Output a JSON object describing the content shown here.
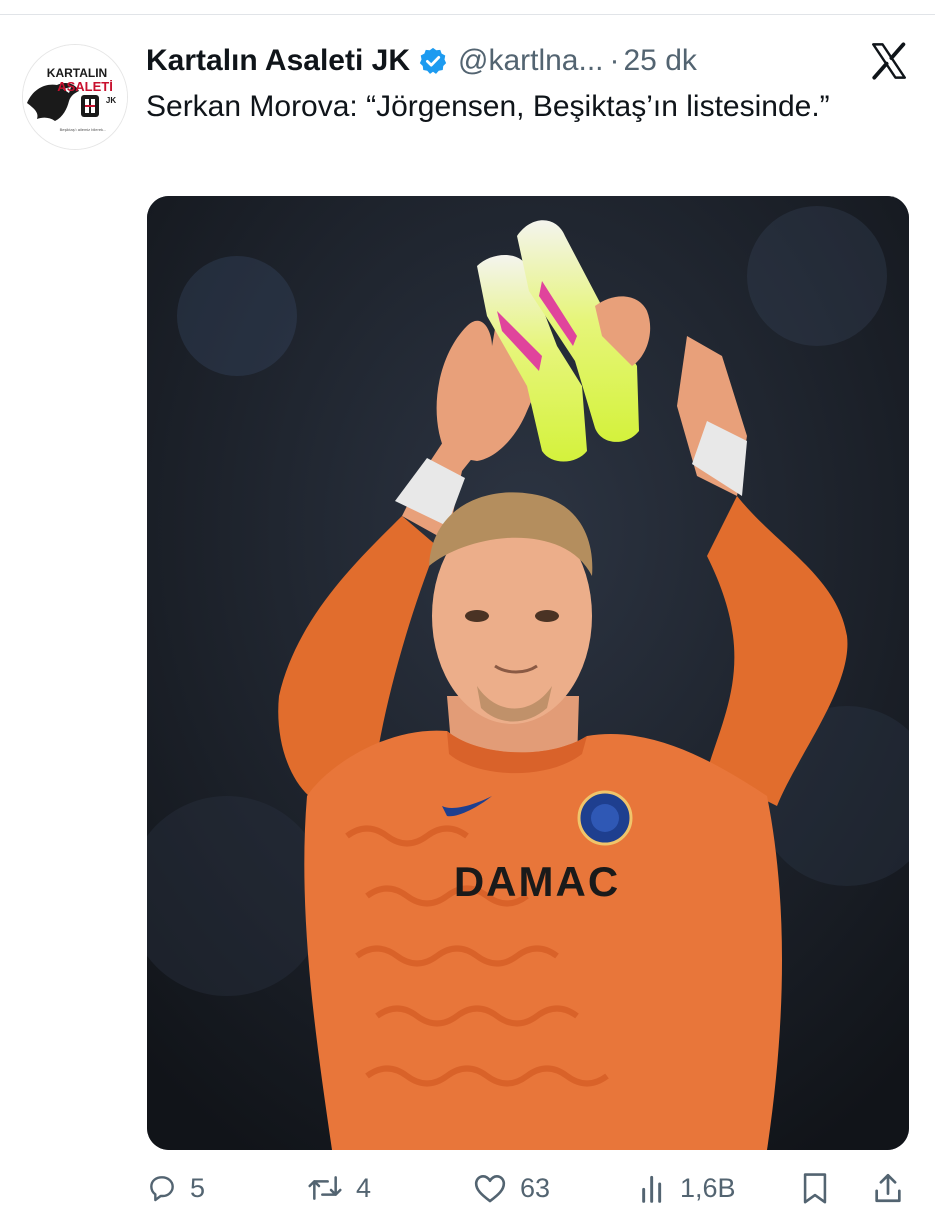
{
  "account": {
    "display_name": "Kartalın Asaleti JK",
    "handle": "@kartlna...",
    "separator": "·",
    "time": "25 dk",
    "avatar_text_top": "KARTALIN",
    "avatar_text_main": "ASALETİ",
    "avatar_text_jk": "JK",
    "avatar_tagline": "Beşiktaş'ı ailemiz bilerek..."
  },
  "tweet": {
    "text": "Serkan Morova: “Jörgensen, Beşiktaş’ın listesinde.”"
  },
  "media": {
    "type": "photo",
    "description_hidden": "",
    "shirt_sponsor": "DAMAC"
  },
  "metrics": {
    "replies": "5",
    "retweets": "4",
    "likes": "63",
    "views": "1,6B"
  },
  "colors": {
    "text": "#0f1419",
    "secondary": "#536471",
    "verified": "#1d9bf0",
    "jersey": "#e8763a"
  },
  "icons": [
    "verified-badge-icon",
    "x-logo-icon",
    "reply-icon",
    "retweet-icon",
    "like-icon",
    "views-icon",
    "bookmark-icon",
    "share-icon"
  ]
}
